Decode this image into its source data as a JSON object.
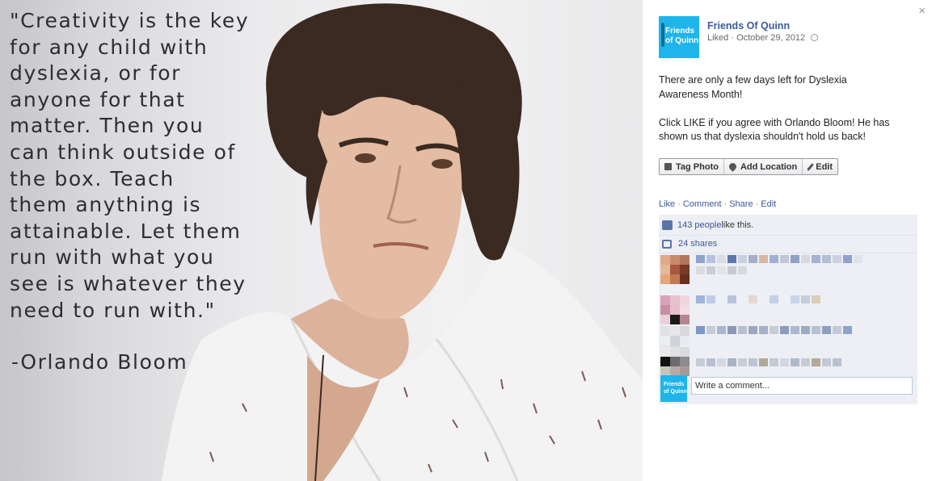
{
  "photo": {
    "quote": "\"Creativity is the key\nfor any child with\ndyslexia, or for\nanyone for that\nmatter. Then you\ncan think outside of\nthe box. Teach\nthem anything is\nattainable. Let them\nrun with what you\nsee is whatever they\nneed to run with.\"",
    "author": "-Orlando Bloom"
  },
  "panel": {
    "close_glyph": "×",
    "page_name": "Friends Of Quinn",
    "logo_line1": "Friends",
    "logo_line2": "of Quinn",
    "meta": "Liked · October 29, 2012",
    "post_text": "There are only a few days left for Dyslexia\nAwareness Month!\n\nClick LIKE if you agree with Orlando Bloom! He has\nshown us that dyslexia shouldn't hold us back!",
    "actions": {
      "tag_photo": "Tag Photo",
      "add_location": "Add Location",
      "edit": "Edit"
    },
    "links": {
      "like": "Like",
      "comment": "Comment",
      "share": "Share",
      "edit": "Edit",
      "sep": "·"
    },
    "likes": {
      "count_link": "143 people",
      "suffix": " like this."
    },
    "shares": {
      "count_link": "24 shares"
    },
    "composer": {
      "placeholder": "Write a comment...",
      "avatar_line1": "Friends",
      "avatar_line2": "of Quinn"
    }
  },
  "colors": {
    "link": "#3b5998",
    "brand_cyan": "#1fb5ea",
    "ufi_background": "#edeff4"
  },
  "icons": [
    "close-icon",
    "tag-icon",
    "location-pin-icon",
    "pencil-icon",
    "globe-icon",
    "thumbs-up-icon",
    "share-icon"
  ]
}
